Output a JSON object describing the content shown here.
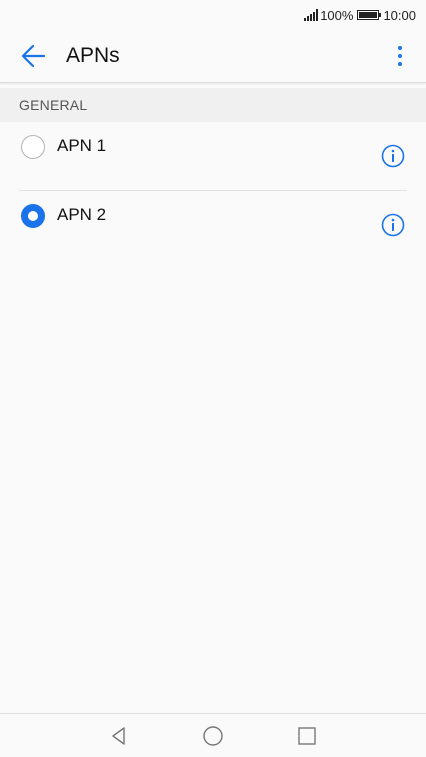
{
  "status_bar": {
    "battery_percent": "100%",
    "time": "10:00"
  },
  "app_bar": {
    "title": "APNs",
    "back_icon": "arrow-left-icon",
    "menu_icon": "more-vert-icon"
  },
  "section": {
    "header": "GENERAL"
  },
  "apns": [
    {
      "label": "APN 1",
      "selected": false
    },
    {
      "label": "APN 2",
      "selected": true
    }
  ],
  "colors": {
    "accent": "#1a73e8",
    "background": "#fafafa"
  }
}
